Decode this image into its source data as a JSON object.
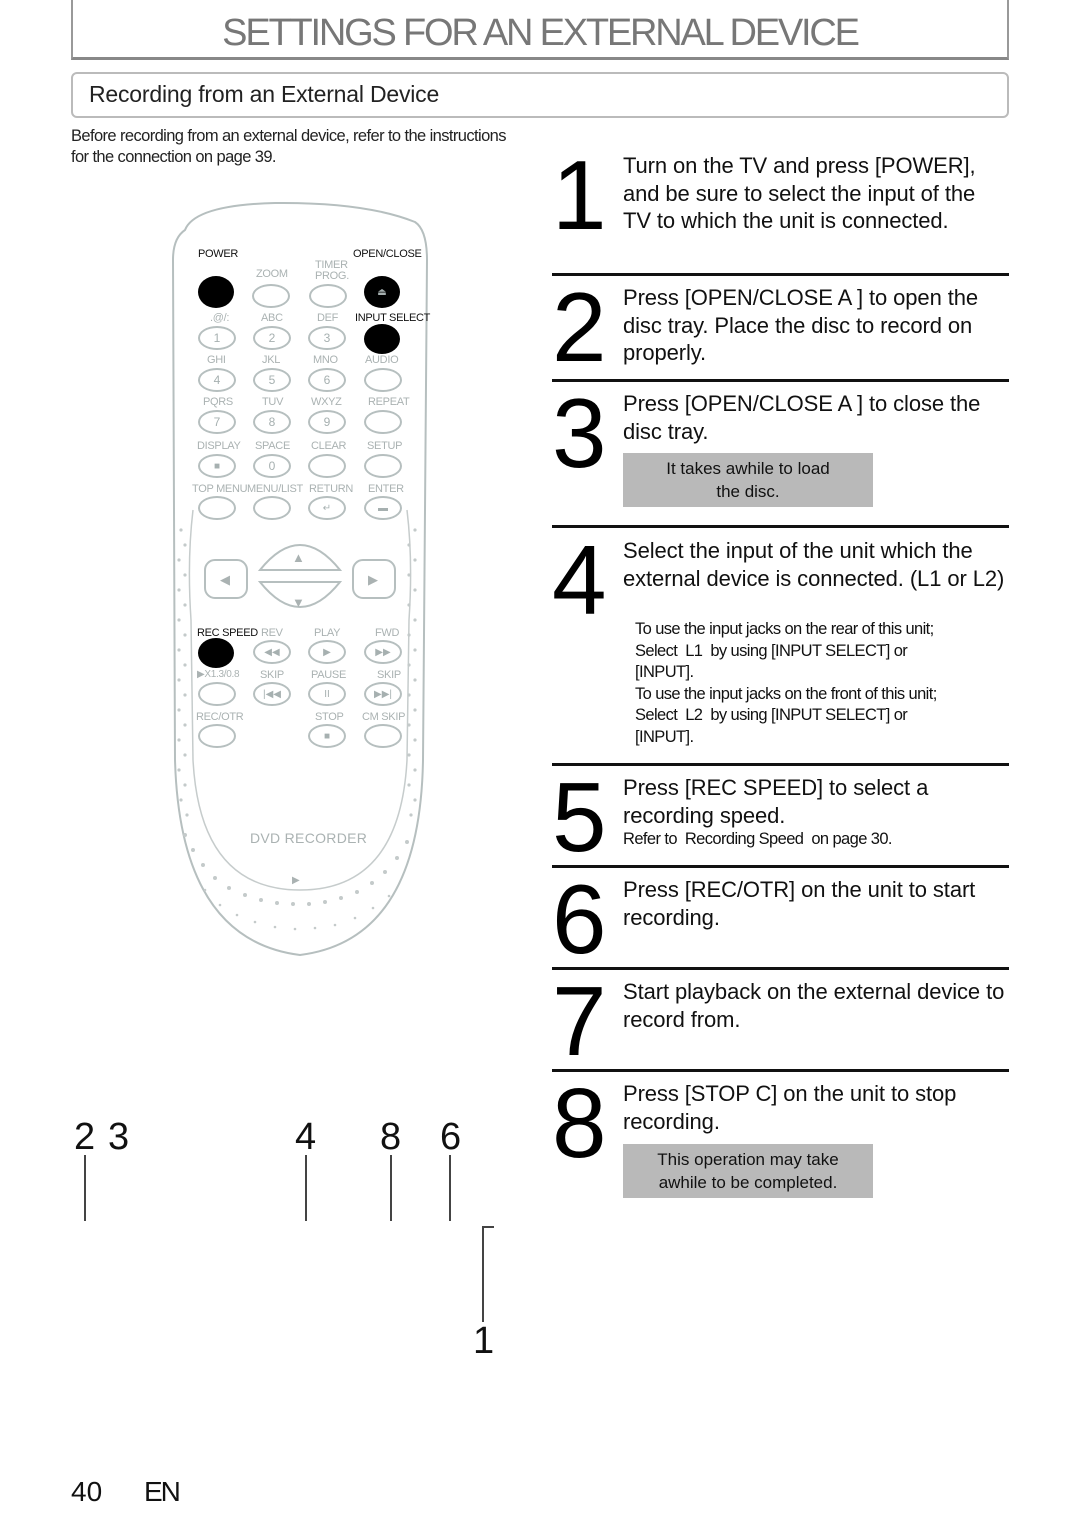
{
  "header": {
    "title": "SETTINGS FOR AN EXTERNAL DEVICE",
    "section_title": "Recording from an External Device"
  },
  "intro": "Before recording from an external device, refer to the instructions for the connection on page 39.",
  "remote": {
    "labels": {
      "power": "POWER",
      "open_close": "OPEN/CLOSE",
      "zoom": "ZOOM",
      "timer_prog_1": "TIMER",
      "timer_prog_2": "PROG.",
      "input_select": "INPUT SELECT",
      "k1": ".@/:",
      "k2": "ABC",
      "k3": "DEF",
      "k4": "GHI",
      "k5": "JKL",
      "k6": "MNO",
      "audio": "AUDIO",
      "k7": "PQRS",
      "k8": "TUV",
      "k9": "WXYZ",
      "repeat": "REPEAT",
      "display": "DISPLAY",
      "space": "SPACE",
      "clear": "CLEAR",
      "setup": "SETUP",
      "top_menu": "TOP MENU",
      "menu_list": "MENU/LIST",
      "return": "RETURN",
      "enter": "ENTER",
      "rec_speed": "REC SPEED",
      "rev": "REV",
      "play": "PLAY",
      "fwd": "FWD",
      "x13": "▶X1.3/0.8",
      "skip_back": "SKIP",
      "pause": "PAUSE",
      "skip_fwd": "SKIP",
      "rec_otr": "REC/OTR",
      "stop": "STOP",
      "cm_skip": "CM SKIP"
    },
    "digits": [
      "1",
      "2",
      "3",
      "4",
      "5",
      "6",
      "7",
      "8",
      "9",
      "0"
    ],
    "glyphs": {
      "eject": "⏏",
      "return": "↵",
      "up": "▲",
      "down": "▼",
      "left": "◀",
      "right": "▶",
      "rev": "◀◀",
      "play": "▶",
      "fwd": "▶▶",
      "skip_back": "|◀◀",
      "pause": "II",
      "skip_fwd": "▶▶|",
      "stop": "■",
      "display": "■",
      "bottom_play": "▶"
    },
    "brand": "DVD RECORDER"
  },
  "callouts": {
    "c2": "2",
    "c3": "3",
    "c4": "4",
    "c8": "8",
    "c6": "6",
    "c1": "1"
  },
  "steps": [
    {
      "num": "1",
      "text": "Turn on the TV and press [POWER], and be sure to select the input of the TV to which the unit is connected."
    },
    {
      "num": "2",
      "text": "Press [OPEN/CLOSE A ] to open the disc tray. Place the disc to record on properly."
    },
    {
      "num": "3",
      "text": "Press [OPEN/CLOSE A ] to close the disc tray.",
      "note": [
        "It takes awhile to load",
        "the disc."
      ]
    },
    {
      "num": "4",
      "text": "Select the input of the unit which the external device is connected. (L1 or L2)",
      "sub": [
        "To use the input jacks on the rear of this unit;",
        "Select  L1  by using [INPUT SELECT] or",
        "[INPUT].",
        "To use the input jacks on the front of this unit;",
        "Select  L2  by using [INPUT SELECT] or",
        "[INPUT]."
      ]
    },
    {
      "num": "5",
      "text": "Press [REC SPEED] to select a recording speed.",
      "sub": [
        "Refer to  Recording Speed  on page 30."
      ]
    },
    {
      "num": "6",
      "text": "Press [REC/OTR] on the unit to start recording."
    },
    {
      "num": "7",
      "text": "Start playback on the external device to record from."
    },
    {
      "num": "8",
      "text": "Press [STOP C] on the unit to stop recording.",
      "note": [
        "This operation may take",
        "awhile to be completed."
      ]
    }
  ],
  "footer": {
    "page": "40",
    "lang": "EN"
  }
}
